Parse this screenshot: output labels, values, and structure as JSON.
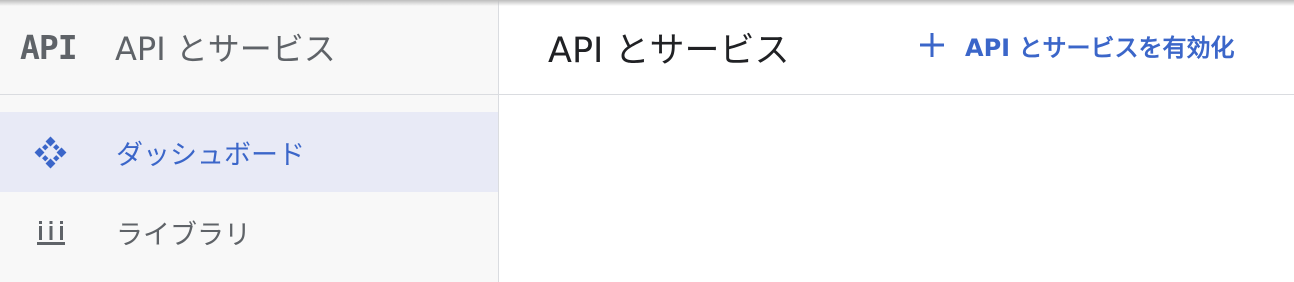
{
  "sidebar": {
    "logo_text": "API",
    "title": "API とサービス",
    "items": [
      {
        "label": "ダッシュボード",
        "icon": "dashboard-icon",
        "active": true
      },
      {
        "label": "ライブラリ",
        "icon": "library-icon",
        "active": false
      }
    ]
  },
  "header": {
    "title": "API とサービス",
    "enable_button": {
      "label": "API とサービスを有効化",
      "icon": "plus-icon"
    }
  },
  "colors": {
    "accent": "#3b66c9",
    "active_bg": "#e8eaf6",
    "muted_text": "#5f6368",
    "sidebar_bg": "#f8f8f8"
  }
}
